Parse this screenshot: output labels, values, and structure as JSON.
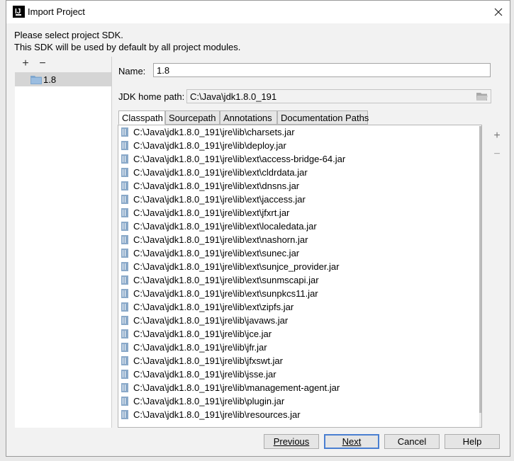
{
  "window": {
    "title": "Import Project"
  },
  "intro": {
    "line1": "Please select project SDK.",
    "line2": "This SDK will be used by default by all project modules."
  },
  "sdk_list": {
    "add_label": "+",
    "remove_label": "−",
    "items": [
      {
        "label": "1.8",
        "icon": "folder-icon"
      }
    ]
  },
  "details": {
    "name_label": "Name:",
    "name_value": "1.8",
    "jdk_label": "JDK home path:",
    "jdk_value": "C:\\Java\\jdk1.8.0_191",
    "tabs": [
      "Classpath",
      "Sourcepath",
      "Annotations",
      "Documentation Paths"
    ],
    "active_tab": "Classpath",
    "classpath": [
      "C:\\Java\\jdk1.8.0_191\\jre\\lib\\charsets.jar",
      "C:\\Java\\jdk1.8.0_191\\jre\\lib\\deploy.jar",
      "C:\\Java\\jdk1.8.0_191\\jre\\lib\\ext\\access-bridge-64.jar",
      "C:\\Java\\jdk1.8.0_191\\jre\\lib\\ext\\cldrdata.jar",
      "C:\\Java\\jdk1.8.0_191\\jre\\lib\\ext\\dnsns.jar",
      "C:\\Java\\jdk1.8.0_191\\jre\\lib\\ext\\jaccess.jar",
      "C:\\Java\\jdk1.8.0_191\\jre\\lib\\ext\\jfxrt.jar",
      "C:\\Java\\jdk1.8.0_191\\jre\\lib\\ext\\localedata.jar",
      "C:\\Java\\jdk1.8.0_191\\jre\\lib\\ext\\nashorn.jar",
      "C:\\Java\\jdk1.8.0_191\\jre\\lib\\ext\\sunec.jar",
      "C:\\Java\\jdk1.8.0_191\\jre\\lib\\ext\\sunjce_provider.jar",
      "C:\\Java\\jdk1.8.0_191\\jre\\lib\\ext\\sunmscapi.jar",
      "C:\\Java\\jdk1.8.0_191\\jre\\lib\\ext\\sunpkcs11.jar",
      "C:\\Java\\jdk1.8.0_191\\jre\\lib\\ext\\zipfs.jar",
      "C:\\Java\\jdk1.8.0_191\\jre\\lib\\javaws.jar",
      "C:\\Java\\jdk1.8.0_191\\jre\\lib\\jce.jar",
      "C:\\Java\\jdk1.8.0_191\\jre\\lib\\jfr.jar",
      "C:\\Java\\jdk1.8.0_191\\jre\\lib\\jfxswt.jar",
      "C:\\Java\\jdk1.8.0_191\\jre\\lib\\jsse.jar",
      "C:\\Java\\jdk1.8.0_191\\jre\\lib\\management-agent.jar",
      "C:\\Java\\jdk1.8.0_191\\jre\\lib\\plugin.jar",
      "C:\\Java\\jdk1.8.0_191\\jre\\lib\\resources.jar"
    ],
    "add_label": "+",
    "remove_label": "−"
  },
  "buttons": {
    "previous": "Previous",
    "next": "Next",
    "cancel": "Cancel",
    "help": "Help"
  },
  "colors": {
    "default_button_border": "#4a7fd1",
    "selection": "#d5d5d5",
    "jar_icon": "#8aa9c9"
  }
}
